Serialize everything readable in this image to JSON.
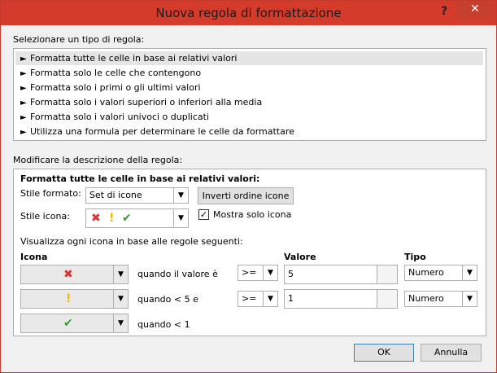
{
  "window": {
    "title": "Nuova regola di formattazione",
    "help": "?",
    "close": "✕"
  },
  "select_type": {
    "label": "Selezionare un tipo di regola:",
    "items": [
      "Formatta tutte le celle in base ai relativi valori",
      "Formatta solo le celle che contengono",
      "Formatta solo i primi o gli ultimi valori",
      "Formatta solo i valori superiori o inferiori alla media",
      "Formatta solo i valori univoci o duplicati",
      "Utilizza una formula per determinare le celle da formattare"
    ]
  },
  "edit": {
    "label": "Modificare la descrizione della regola:",
    "heading": "Formatta tutte le celle in base ai relativi valori:",
    "style_label": "Stile formato:",
    "style_value": "Set di icone",
    "reverse_button": "Inverti ordine icone",
    "icon_style_label": "Stile icona:",
    "show_icon_only": "Mostra solo icona",
    "show_icon_only_checked": "✓",
    "rules_caption": "Visualizza ogni icona in base alle regole seguenti:",
    "col_icon": "Icona",
    "col_value": "Valore",
    "col_type": "Tipo",
    "rows": [
      {
        "icon": "red-x-icon",
        "condition": "quando il valore è",
        "operator": ">=",
        "value": "5",
        "type": "Numero"
      },
      {
        "icon": "yellow-exclamation-icon",
        "condition": "quando < 5 e",
        "operator": ">=",
        "value": "1",
        "type": "Numero"
      },
      {
        "icon": "green-check-icon",
        "condition": "quando < 1"
      }
    ]
  },
  "buttons": {
    "ok": "OK",
    "cancel": "Annulla"
  }
}
